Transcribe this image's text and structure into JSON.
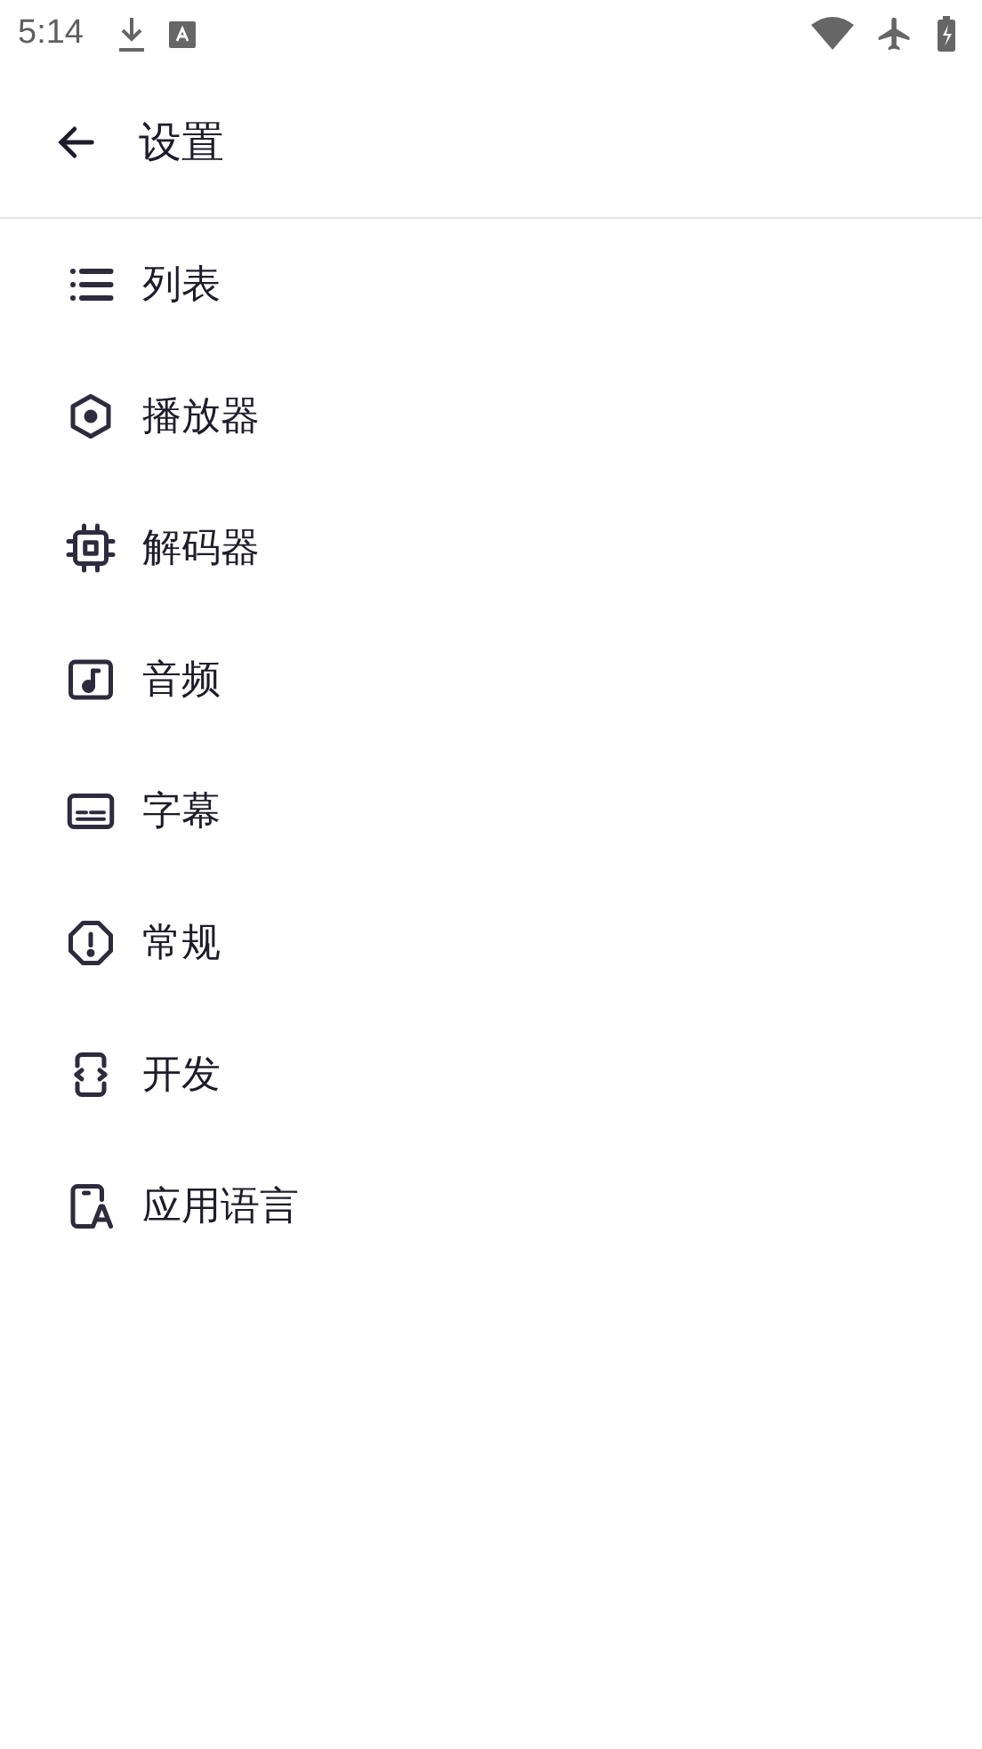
{
  "status_bar": {
    "time": "5:14"
  },
  "app_bar": {
    "title": "设置"
  },
  "items": [
    {
      "label": "列表",
      "kind": "list"
    },
    {
      "label": "播放器",
      "kind": "player"
    },
    {
      "label": "解码器",
      "kind": "decoder"
    },
    {
      "label": "音频",
      "kind": "audio"
    },
    {
      "label": "字幕",
      "kind": "subtitle"
    },
    {
      "label": "常规",
      "kind": "general"
    },
    {
      "label": "开发",
      "kind": "develop"
    },
    {
      "label": "应用语言",
      "kind": "language"
    }
  ]
}
